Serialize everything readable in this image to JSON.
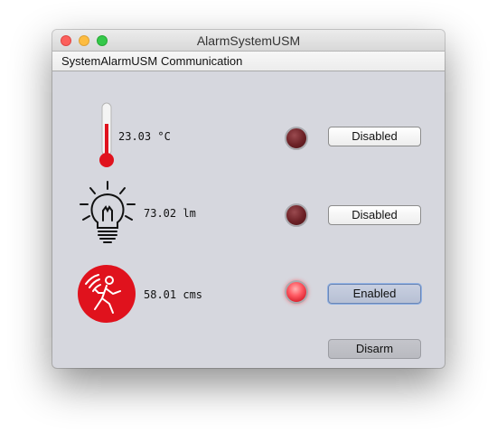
{
  "window": {
    "title": "AlarmSystemUSM"
  },
  "menubar": {
    "items": [
      "SystemAlarmUSM",
      "Communication"
    ]
  },
  "sensors": [
    {
      "icon": "thermometer-icon",
      "value": "23.03 °C",
      "led": "off",
      "button_label": "Disabled"
    },
    {
      "icon": "light-bulb-icon",
      "value": "73.02 lm",
      "led": "off",
      "button_label": "Disabled"
    },
    {
      "icon": "motion-sensor-icon",
      "value": "58.01 cms",
      "led": "on",
      "button_label": "Enabled"
    }
  ],
  "actions": {
    "disarm_label": "Disarm"
  },
  "colors": {
    "window_bg": "#d6d7de",
    "led_on": "#ff5a63",
    "led_off": "#6c2126",
    "alarm_red": "#e0121d"
  }
}
